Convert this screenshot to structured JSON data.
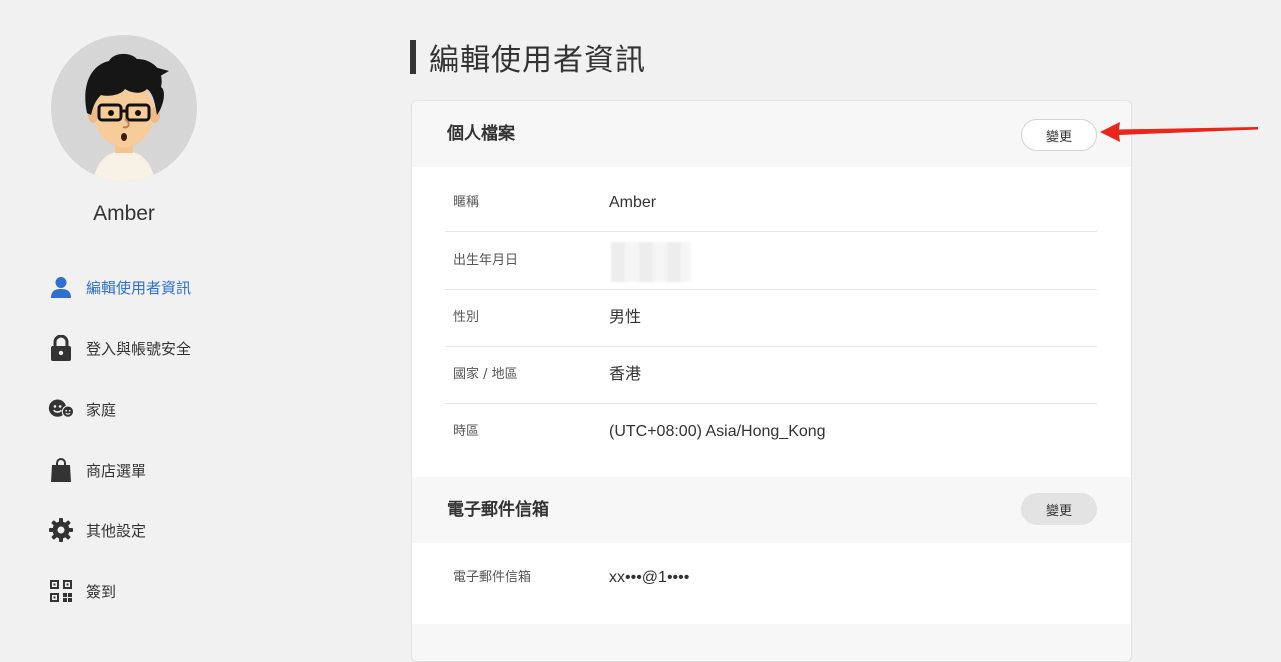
{
  "sidebar": {
    "username": "Amber",
    "items": [
      {
        "label": "編輯使用者資訊",
        "icon": "person-icon",
        "active": true
      },
      {
        "label": "登入與帳號安全",
        "icon": "lock-icon",
        "active": false
      },
      {
        "label": "家庭",
        "icon": "family-icon",
        "active": false
      },
      {
        "label": "商店選單",
        "icon": "shopping-bag-icon",
        "active": false
      },
      {
        "label": "其他設定",
        "icon": "gear-icon",
        "active": false
      },
      {
        "label": "簽到",
        "icon": "qr-code-icon",
        "active": false
      }
    ]
  },
  "main": {
    "title": "編輯使用者資訊",
    "profile": {
      "title": "個人檔案",
      "change_label": "變更",
      "rows": [
        {
          "label": "暱稱",
          "value": "Amber"
        },
        {
          "label": "出生年月日",
          "value": ""
        },
        {
          "label": "性別",
          "value": "男性"
        },
        {
          "label": "國家 / 地區",
          "value": "香港"
        },
        {
          "label": "時區",
          "value": "(UTC+08:00) Asia/Hong_Kong"
        }
      ]
    },
    "email": {
      "title": "電子郵件信箱",
      "change_label": "變更",
      "rows": [
        {
          "label": "電子郵件信箱",
          "value": "xx•••@1••••"
        }
      ]
    }
  },
  "colors": {
    "accent": "#2f6fd0",
    "annotation_arrow": "#e8261c",
    "background": "#f1f1f1"
  }
}
